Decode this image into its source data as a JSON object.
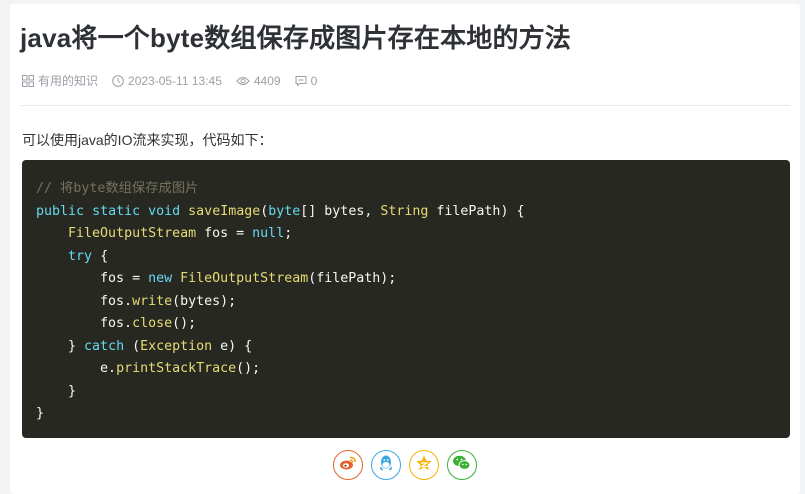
{
  "article": {
    "title": "java将一个byte数组保存成图片存在本地的方法",
    "category": "有用的知识",
    "datetime": "2023-05-11 13:45",
    "views": "4409",
    "comments": "0",
    "intro": "可以使用java的IO流来实现，代码如下："
  },
  "code": {
    "lines": [
      [
        [
          "c-comment",
          "// 将byte数组保存成图片"
        ]
      ],
      [
        [
          "c-kw",
          "public"
        ],
        [
          "c-op",
          " "
        ],
        [
          "c-kw",
          "static"
        ],
        [
          "c-op",
          " "
        ],
        [
          "c-kw",
          "void"
        ],
        [
          "c-op",
          " "
        ],
        [
          "c-fn",
          "saveImage"
        ],
        [
          "c-op",
          "("
        ],
        [
          "c-kw",
          "byte"
        ],
        [
          "c-op",
          "[] bytes, "
        ],
        [
          "c-type",
          "String"
        ],
        [
          "c-op",
          " filePath) {"
        ]
      ],
      [
        [
          "c-op",
          "    "
        ],
        [
          "c-type",
          "FileOutputStream"
        ],
        [
          "c-op",
          " fos = "
        ],
        [
          "c-kw",
          "null"
        ],
        [
          "c-op",
          ";"
        ]
      ],
      [
        [
          "c-op",
          "    "
        ],
        [
          "c-kw",
          "try"
        ],
        [
          "c-op",
          " {"
        ]
      ],
      [
        [
          "c-op",
          "        fos = "
        ],
        [
          "c-kw",
          "new"
        ],
        [
          "c-op",
          " "
        ],
        [
          "c-type",
          "FileOutputStream"
        ],
        [
          "c-op",
          "(filePath);"
        ]
      ],
      [
        [
          "c-op",
          "        fos."
        ],
        [
          "c-fn",
          "write"
        ],
        [
          "c-op",
          "(bytes);"
        ]
      ],
      [
        [
          "c-op",
          "        fos."
        ],
        [
          "c-fn",
          "close"
        ],
        [
          "c-op",
          "();"
        ]
      ],
      [
        [
          "c-op",
          "    } "
        ],
        [
          "c-kw",
          "catch"
        ],
        [
          "c-op",
          " ("
        ],
        [
          "c-type",
          "Exception"
        ],
        [
          "c-op",
          " e) {"
        ]
      ],
      [
        [
          "c-op",
          "        e."
        ],
        [
          "c-fn",
          "printStackTrace"
        ],
        [
          "c-op",
          "();"
        ]
      ],
      [
        [
          "c-op",
          "    }"
        ]
      ],
      [
        [
          "c-op",
          "}"
        ]
      ]
    ]
  },
  "icons": {
    "category": "grid-icon",
    "time": "clock-icon",
    "views": "eye-icon",
    "comments": "comment-icon",
    "share": [
      "weibo-icon",
      "qq-icon",
      "qzone-icon",
      "wechat-icon"
    ]
  },
  "colors": {
    "code_bg": "#272822",
    "weibo": "#e6632f",
    "qq": "#3aa8df",
    "qzone": "#f4b400",
    "wechat": "#3cb034"
  }
}
